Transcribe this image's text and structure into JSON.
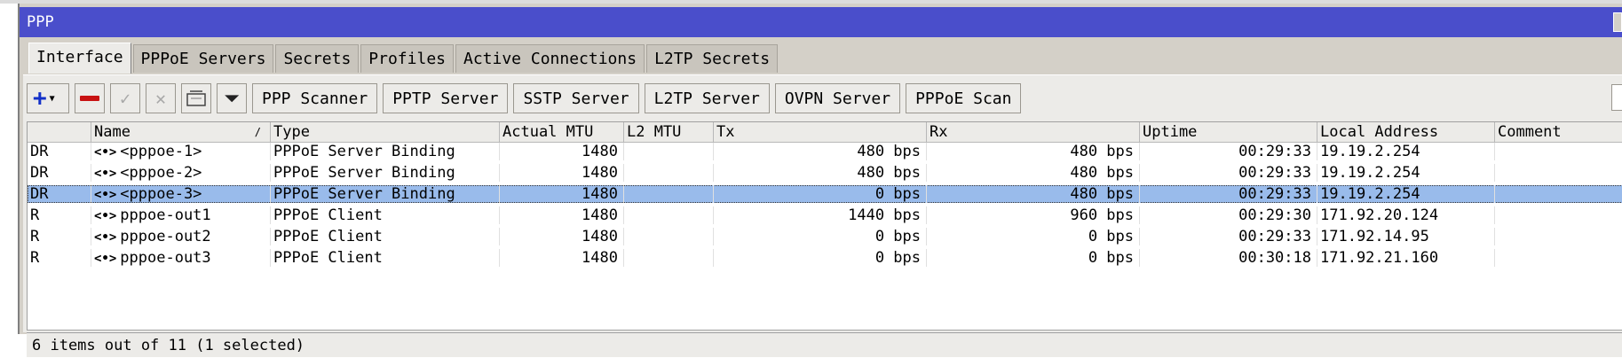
{
  "window": {
    "title": "PPP"
  },
  "tabs": [
    "Interface",
    "PPPoE Servers",
    "Secrets",
    "Profiles",
    "Active Connections",
    "L2TP Secrets"
  ],
  "toolbar": {
    "buttons": [
      "PPP Scanner",
      "PPTP Server",
      "SSTP Server",
      "L2TP Server",
      "OVPN Server",
      "PPPoE Scan"
    ],
    "icons": [
      "add-icon",
      "remove-icon",
      "enable-icon",
      "disable-icon",
      "comment-icon",
      "filter-icon"
    ]
  },
  "table": {
    "columns": [
      "",
      "Name",
      "Type",
      "Actual MTU",
      "L2 MTU",
      "Tx",
      "Rx",
      "Uptime",
      "Local Address",
      "Comment"
    ],
    "sort_indicator": "/",
    "rows": [
      {
        "flags": "DR",
        "icon": "<•>",
        "name": "<pppoe-1>",
        "type": "PPPoE Server Binding",
        "mtu": "1480",
        "l2mtu": "",
        "tx": "480 bps",
        "rx": "480 bps",
        "uptime": "00:29:33",
        "local": "19.19.2.254",
        "comment": ""
      },
      {
        "flags": "DR",
        "icon": "<•>",
        "name": "<pppoe-2>",
        "type": "PPPoE Server Binding",
        "mtu": "1480",
        "l2mtu": "",
        "tx": "480 bps",
        "rx": "480 bps",
        "uptime": "00:29:33",
        "local": "19.19.2.254",
        "comment": ""
      },
      {
        "flags": "DR",
        "icon": "<•>",
        "name": "<pppoe-3>",
        "type": "PPPoE Server Binding",
        "mtu": "1480",
        "l2mtu": "",
        "tx": "0 bps",
        "rx": "480 bps",
        "uptime": "00:29:33",
        "local": "19.19.2.254",
        "comment": ""
      },
      {
        "flags": "R",
        "icon": "<•>",
        "name": "pppoe-out1",
        "type": "PPPoE Client",
        "mtu": "1480",
        "l2mtu": "",
        "tx": "1440 bps",
        "rx": "960 bps",
        "uptime": "00:29:30",
        "local": "171.92.20.124",
        "comment": ""
      },
      {
        "flags": "R",
        "icon": "<•>",
        "name": "pppoe-out2",
        "type": "PPPoE Client",
        "mtu": "1480",
        "l2mtu": "",
        "tx": "0 bps",
        "rx": "0 bps",
        "uptime": "00:29:33",
        "local": "171.92.14.95",
        "comment": ""
      },
      {
        "flags": "R",
        "icon": "<•>",
        "name": "pppoe-out3",
        "type": "PPPoE Client",
        "mtu": "1480",
        "l2mtu": "",
        "tx": "0 bps",
        "rx": "0 bps",
        "uptime": "00:30:18",
        "local": "171.92.21.160",
        "comment": ""
      }
    ],
    "selected_row": 2
  },
  "status": {
    "text": "6 items out of 11 (1 selected)"
  }
}
